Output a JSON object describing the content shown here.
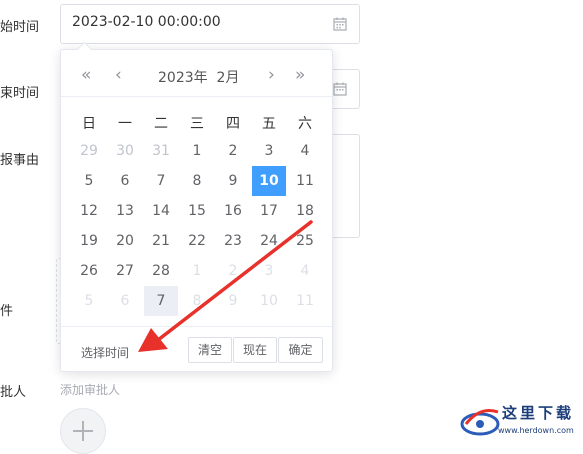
{
  "form": {
    "start_label": "始时间",
    "end_label": "束时间",
    "reason_label": "报事由",
    "attach_label": "件",
    "approver_label": "批人",
    "start_value": "2023-02-10 00:00:00",
    "add_approver": "添加审批人"
  },
  "picker": {
    "year_label": "2023年",
    "month_label": "2月",
    "weekdays": [
      "日",
      "一",
      "二",
      "三",
      "四",
      "五",
      "六"
    ],
    "weeks": [
      [
        "29",
        "30",
        "31",
        "1",
        "2",
        "3",
        "4"
      ],
      [
        "5",
        "6",
        "7",
        "8",
        "9",
        "10",
        "11"
      ],
      [
        "12",
        "13",
        "14",
        "15",
        "16",
        "17",
        "18"
      ],
      [
        "19",
        "20",
        "21",
        "22",
        "23",
        "24",
        "25"
      ],
      [
        "26",
        "27",
        "28",
        "1",
        "2",
        "3",
        "4"
      ],
      [
        "5",
        "6",
        "7",
        "8",
        "9",
        "10",
        "11"
      ]
    ],
    "select_time": "选择时间",
    "clear_label": "清空",
    "now_label": "现在",
    "ok_label": "确定"
  },
  "watermark": {
    "text": "这里下载",
    "url": "www.herdown.com"
  },
  "colors": {
    "selected": "#409eff",
    "annotation_arrow": "#e8312a"
  }
}
